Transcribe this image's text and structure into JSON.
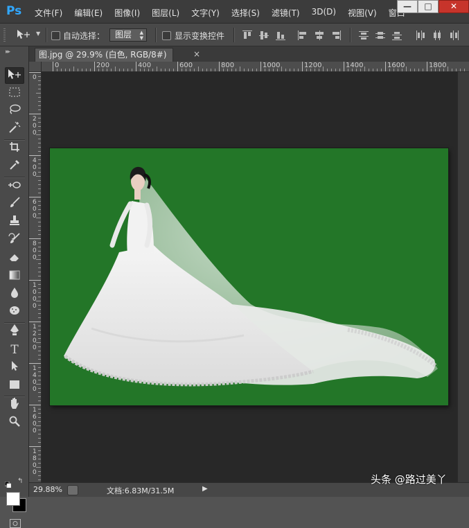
{
  "app": {
    "logo": "Ps"
  },
  "menu": [
    "文件(F)",
    "编辑(E)",
    "图像(I)",
    "图层(L)",
    "文字(Y)",
    "选择(S)",
    "滤镜(T)",
    "3D(D)",
    "视图(V)",
    "窗口"
  ],
  "window_controls": {
    "minimize": "—",
    "maximize": "□",
    "close": "✕"
  },
  "options": {
    "auto_select_label": "自动选择：",
    "layer_select_value": "图层",
    "show_transform_label": "显示变换控件"
  },
  "document": {
    "tab_title": "图.jpg @ 29.9% (白色, RGB/8#) *",
    "tab_close": "×",
    "canvas_color": "#237628"
  },
  "ruler": {
    "h_labels": [
      "0",
      "200",
      "400",
      "600",
      "800",
      "1000",
      "1200",
      "1400",
      "1600",
      "1800"
    ],
    "v_labels": [
      "0",
      "200",
      "400",
      "600",
      "800",
      "1000",
      "1200",
      "1400",
      "1600",
      "1800"
    ]
  },
  "status": {
    "zoom": "29.88%",
    "doc_size": "文档:6.83M/31.5M",
    "arrow": "▶"
  },
  "watermark": "头条 @路过美丫",
  "colors": {
    "foreground": "#ffffff",
    "background": "#000000",
    "accent": "#31a8ff"
  }
}
